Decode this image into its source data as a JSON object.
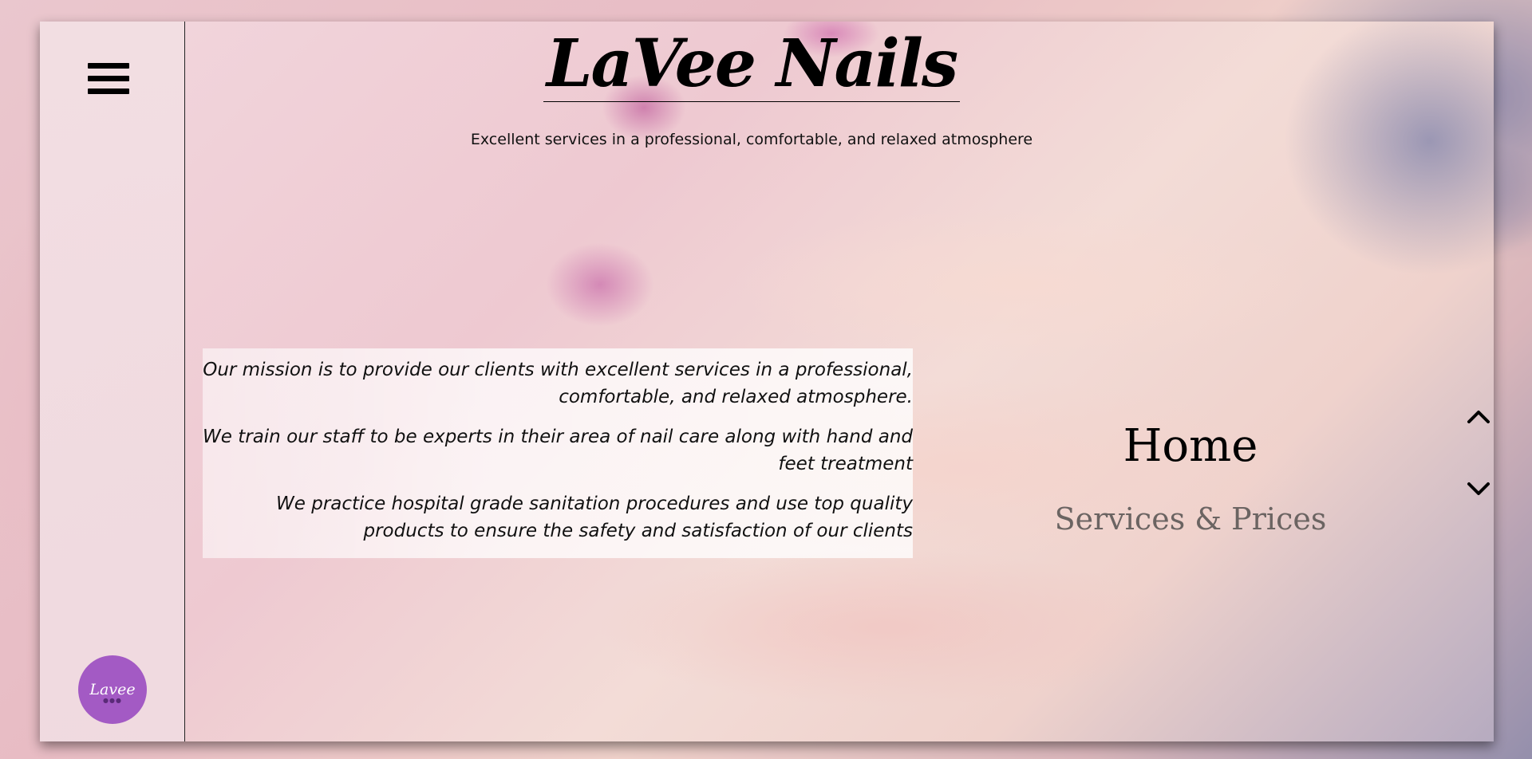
{
  "brand": {
    "title": "LaVee Nails",
    "tagline": "Excellent services in a professional, comfortable, and relaxed atmosphere",
    "badge_text": "Lavee",
    "badge_color": "#a35ac4"
  },
  "mission": {
    "paragraphs": [
      "Our mission is to provide our clients with excellent services in a professional, comfortable, and relaxed atmosphere.",
      "We train our staff to be experts in their area of nail care along with hand and feet treatment",
      "We practice hospital grade sanitation procedures and use top quality products to ensure the safety and satisfaction of our clients"
    ]
  },
  "nav": {
    "items": [
      {
        "label": "Home",
        "active": true
      },
      {
        "label": "Services & Prices",
        "active": false
      }
    ],
    "prev_icon": "chevron-up-icon",
    "next_icon": "chevron-down-icon"
  },
  "menu": {
    "icon": "hamburger-menu-icon"
  }
}
